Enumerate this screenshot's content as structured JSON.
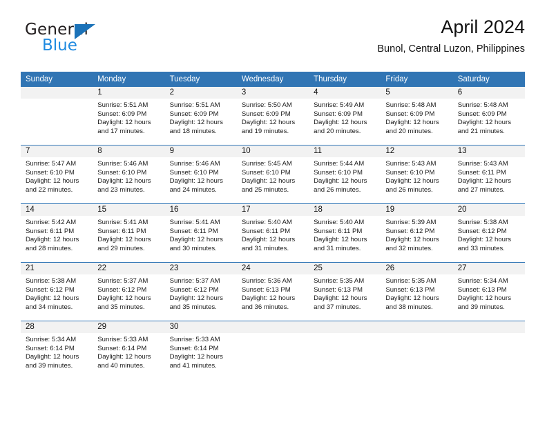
{
  "brand": {
    "name_top": "General",
    "name_bottom": "Blue",
    "flag_icon": "blue-triangle-flag-icon",
    "color_top": "#231f20",
    "color_bottom": "#1f8ae0",
    "flag_color": "#1b72b8"
  },
  "header": {
    "title": "April 2024",
    "subtitle": "Bunol, Central Luzon, Philippines"
  },
  "theme": {
    "header_bg": "#3175b4",
    "row_divider": "#2e74b5",
    "daynum_bg": "#f2f2f2",
    "text": "#111111"
  },
  "weekdays": [
    "Sunday",
    "Monday",
    "Tuesday",
    "Wednesday",
    "Thursday",
    "Friday",
    "Saturday"
  ],
  "weeks": [
    [
      {
        "day": "",
        "sunrise": "",
        "sunset": "",
        "daylight_1": "",
        "daylight_2": "",
        "blank": true
      },
      {
        "day": "1",
        "sunrise": "Sunrise: 5:51 AM",
        "sunset": "Sunset: 6:09 PM",
        "daylight_1": "Daylight: 12 hours",
        "daylight_2": "and 17 minutes."
      },
      {
        "day": "2",
        "sunrise": "Sunrise: 5:51 AM",
        "sunset": "Sunset: 6:09 PM",
        "daylight_1": "Daylight: 12 hours",
        "daylight_2": "and 18 minutes."
      },
      {
        "day": "3",
        "sunrise": "Sunrise: 5:50 AM",
        "sunset": "Sunset: 6:09 PM",
        "daylight_1": "Daylight: 12 hours",
        "daylight_2": "and 19 minutes."
      },
      {
        "day": "4",
        "sunrise": "Sunrise: 5:49 AM",
        "sunset": "Sunset: 6:09 PM",
        "daylight_1": "Daylight: 12 hours",
        "daylight_2": "and 20 minutes."
      },
      {
        "day": "5",
        "sunrise": "Sunrise: 5:48 AM",
        "sunset": "Sunset: 6:09 PM",
        "daylight_1": "Daylight: 12 hours",
        "daylight_2": "and 20 minutes."
      },
      {
        "day": "6",
        "sunrise": "Sunrise: 5:48 AM",
        "sunset": "Sunset: 6:09 PM",
        "daylight_1": "Daylight: 12 hours",
        "daylight_2": "and 21 minutes."
      }
    ],
    [
      {
        "day": "7",
        "sunrise": "Sunrise: 5:47 AM",
        "sunset": "Sunset: 6:10 PM",
        "daylight_1": "Daylight: 12 hours",
        "daylight_2": "and 22 minutes."
      },
      {
        "day": "8",
        "sunrise": "Sunrise: 5:46 AM",
        "sunset": "Sunset: 6:10 PM",
        "daylight_1": "Daylight: 12 hours",
        "daylight_2": "and 23 minutes."
      },
      {
        "day": "9",
        "sunrise": "Sunrise: 5:46 AM",
        "sunset": "Sunset: 6:10 PM",
        "daylight_1": "Daylight: 12 hours",
        "daylight_2": "and 24 minutes."
      },
      {
        "day": "10",
        "sunrise": "Sunrise: 5:45 AM",
        "sunset": "Sunset: 6:10 PM",
        "daylight_1": "Daylight: 12 hours",
        "daylight_2": "and 25 minutes."
      },
      {
        "day": "11",
        "sunrise": "Sunrise: 5:44 AM",
        "sunset": "Sunset: 6:10 PM",
        "daylight_1": "Daylight: 12 hours",
        "daylight_2": "and 26 minutes."
      },
      {
        "day": "12",
        "sunrise": "Sunrise: 5:43 AM",
        "sunset": "Sunset: 6:10 PM",
        "daylight_1": "Daylight: 12 hours",
        "daylight_2": "and 26 minutes."
      },
      {
        "day": "13",
        "sunrise": "Sunrise: 5:43 AM",
        "sunset": "Sunset: 6:11 PM",
        "daylight_1": "Daylight: 12 hours",
        "daylight_2": "and 27 minutes."
      }
    ],
    [
      {
        "day": "14",
        "sunrise": "Sunrise: 5:42 AM",
        "sunset": "Sunset: 6:11 PM",
        "daylight_1": "Daylight: 12 hours",
        "daylight_2": "and 28 minutes."
      },
      {
        "day": "15",
        "sunrise": "Sunrise: 5:41 AM",
        "sunset": "Sunset: 6:11 PM",
        "daylight_1": "Daylight: 12 hours",
        "daylight_2": "and 29 minutes."
      },
      {
        "day": "16",
        "sunrise": "Sunrise: 5:41 AM",
        "sunset": "Sunset: 6:11 PM",
        "daylight_1": "Daylight: 12 hours",
        "daylight_2": "and 30 minutes."
      },
      {
        "day": "17",
        "sunrise": "Sunrise: 5:40 AM",
        "sunset": "Sunset: 6:11 PM",
        "daylight_1": "Daylight: 12 hours",
        "daylight_2": "and 31 minutes."
      },
      {
        "day": "18",
        "sunrise": "Sunrise: 5:40 AM",
        "sunset": "Sunset: 6:11 PM",
        "daylight_1": "Daylight: 12 hours",
        "daylight_2": "and 31 minutes."
      },
      {
        "day": "19",
        "sunrise": "Sunrise: 5:39 AM",
        "sunset": "Sunset: 6:12 PM",
        "daylight_1": "Daylight: 12 hours",
        "daylight_2": "and 32 minutes."
      },
      {
        "day": "20",
        "sunrise": "Sunrise: 5:38 AM",
        "sunset": "Sunset: 6:12 PM",
        "daylight_1": "Daylight: 12 hours",
        "daylight_2": "and 33 minutes."
      }
    ],
    [
      {
        "day": "21",
        "sunrise": "Sunrise: 5:38 AM",
        "sunset": "Sunset: 6:12 PM",
        "daylight_1": "Daylight: 12 hours",
        "daylight_2": "and 34 minutes."
      },
      {
        "day": "22",
        "sunrise": "Sunrise: 5:37 AM",
        "sunset": "Sunset: 6:12 PM",
        "daylight_1": "Daylight: 12 hours",
        "daylight_2": "and 35 minutes."
      },
      {
        "day": "23",
        "sunrise": "Sunrise: 5:37 AM",
        "sunset": "Sunset: 6:12 PM",
        "daylight_1": "Daylight: 12 hours",
        "daylight_2": "and 35 minutes."
      },
      {
        "day": "24",
        "sunrise": "Sunrise: 5:36 AM",
        "sunset": "Sunset: 6:13 PM",
        "daylight_1": "Daylight: 12 hours",
        "daylight_2": "and 36 minutes."
      },
      {
        "day": "25",
        "sunrise": "Sunrise: 5:35 AM",
        "sunset": "Sunset: 6:13 PM",
        "daylight_1": "Daylight: 12 hours",
        "daylight_2": "and 37 minutes."
      },
      {
        "day": "26",
        "sunrise": "Sunrise: 5:35 AM",
        "sunset": "Sunset: 6:13 PM",
        "daylight_1": "Daylight: 12 hours",
        "daylight_2": "and 38 minutes."
      },
      {
        "day": "27",
        "sunrise": "Sunrise: 5:34 AM",
        "sunset": "Sunset: 6:13 PM",
        "daylight_1": "Daylight: 12 hours",
        "daylight_2": "and 39 minutes."
      }
    ],
    [
      {
        "day": "28",
        "sunrise": "Sunrise: 5:34 AM",
        "sunset": "Sunset: 6:14 PM",
        "daylight_1": "Daylight: 12 hours",
        "daylight_2": "and 39 minutes."
      },
      {
        "day": "29",
        "sunrise": "Sunrise: 5:33 AM",
        "sunset": "Sunset: 6:14 PM",
        "daylight_1": "Daylight: 12 hours",
        "daylight_2": "and 40 minutes."
      },
      {
        "day": "30",
        "sunrise": "Sunrise: 5:33 AM",
        "sunset": "Sunset: 6:14 PM",
        "daylight_1": "Daylight: 12 hours",
        "daylight_2": "and 41 minutes."
      },
      {
        "day": "",
        "sunrise": "",
        "sunset": "",
        "daylight_1": "",
        "daylight_2": "",
        "blank": true
      },
      {
        "day": "",
        "sunrise": "",
        "sunset": "",
        "daylight_1": "",
        "daylight_2": "",
        "blank": true
      },
      {
        "day": "",
        "sunrise": "",
        "sunset": "",
        "daylight_1": "",
        "daylight_2": "",
        "blank": true
      },
      {
        "day": "",
        "sunrise": "",
        "sunset": "",
        "daylight_1": "",
        "daylight_2": "",
        "blank": true
      }
    ]
  ]
}
